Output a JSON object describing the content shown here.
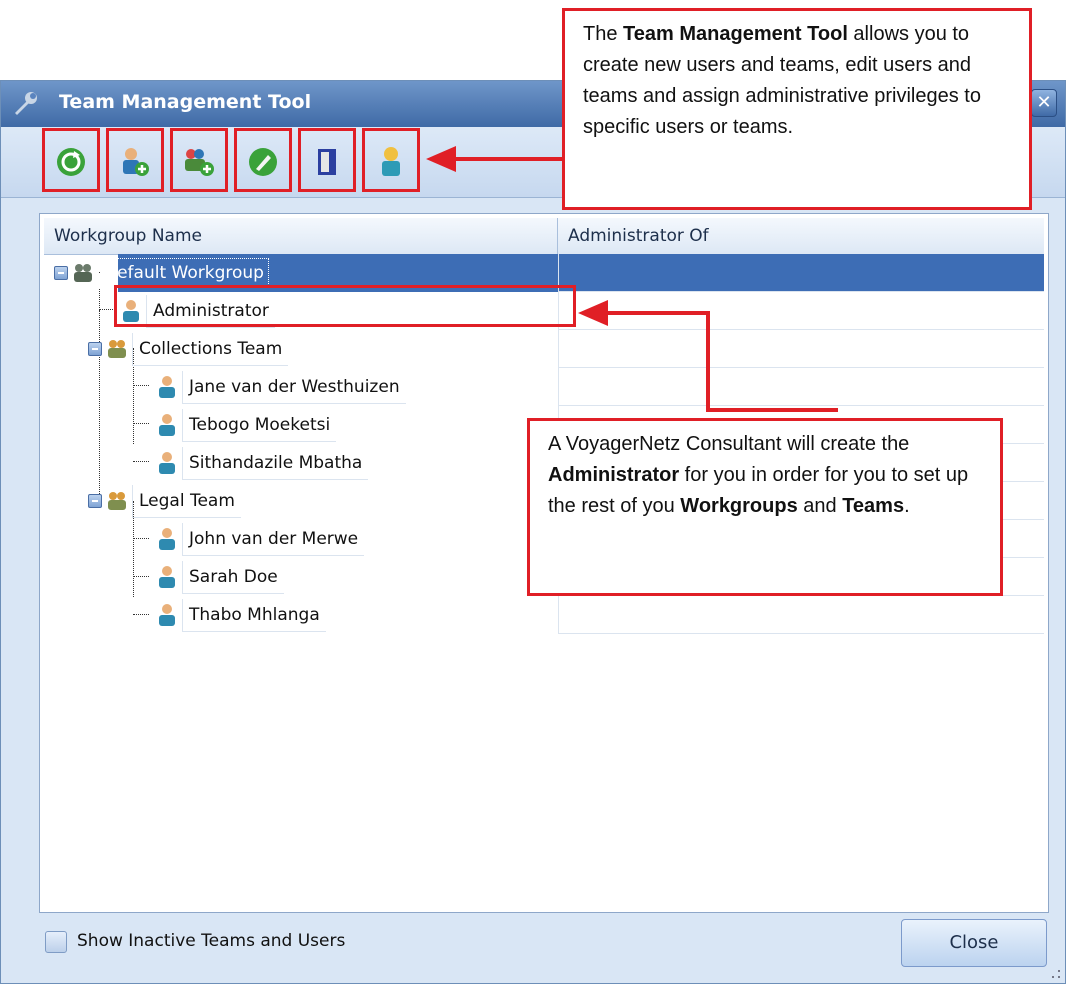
{
  "window": {
    "title": "Team Management Tool",
    "min_label": "",
    "close_label": "✕"
  },
  "toolbar": {
    "buttons": [
      {
        "name": "refresh",
        "icon": "refresh-icon"
      },
      {
        "name": "add-user",
        "icon": "add-user-icon"
      },
      {
        "name": "add-team",
        "icon": "add-team-icon"
      },
      {
        "name": "edit",
        "icon": "edit-icon"
      },
      {
        "name": "deactivate",
        "icon": "deactivate-icon"
      },
      {
        "name": "assign-admin",
        "icon": "admin-user-icon"
      }
    ]
  },
  "tree": {
    "headers": [
      "Workgroup Name",
      "Administrator Of"
    ],
    "rows": [
      {
        "label": "Default Workgroup",
        "type": "workgroup",
        "selected": true
      },
      {
        "label": "Administrator",
        "type": "user"
      },
      {
        "label": "Collections Team",
        "type": "team"
      },
      {
        "label": "Jane van der Westhuizen",
        "type": "user"
      },
      {
        "label": "Tebogo Moeketsi",
        "type": "user"
      },
      {
        "label": "Sithandazile Mbatha",
        "type": "user"
      },
      {
        "label": "Legal Team",
        "type": "team"
      },
      {
        "label": "John van der Merwe",
        "type": "user"
      },
      {
        "label": "Sarah Doe",
        "type": "user"
      },
      {
        "label": "Thabo Mhlanga",
        "type": "user"
      }
    ]
  },
  "footer": {
    "show_inactive_label": "Show Inactive Teams and Users",
    "show_inactive_checked": false,
    "close_label": "Close"
  },
  "callouts": {
    "toolbar_note": {
      "pre": "The ",
      "bold": "Team Management Tool",
      "post": " allows you to create new users and teams, edit users and teams and assign administrative privileges to specific users or teams."
    },
    "admin_note": {
      "p1": "A VoyagerNetz Consultant will create the ",
      "b1": "Administrator",
      "p2": " for you in order for you to set up the rest of you ",
      "b2": "Workgroups",
      "p3": " and ",
      "b3": "Teams",
      "p4": "."
    }
  },
  "colors": {
    "highlight": "#e01f26",
    "selection": "#3d6db5",
    "titlebar": "#4f7bb6"
  }
}
